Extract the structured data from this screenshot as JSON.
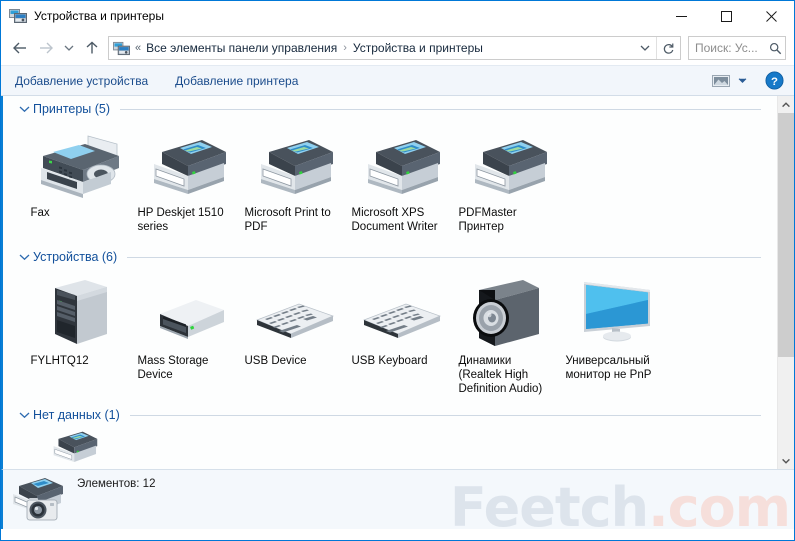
{
  "window": {
    "title": "Устройства и принтеры",
    "title_icon": "devices-printers-icon",
    "minimize_label": "─",
    "maximize_label": "□",
    "close_label": "✕"
  },
  "nav": {
    "back_icon": "back-arrow-icon",
    "forward_icon": "forward-arrow-icon",
    "recent_icon": "chevron-down-icon",
    "up_icon": "up-arrow-icon",
    "address_icon": "devices-printers-icon",
    "overflow": "«",
    "breadcrumbs": [
      "Все элементы панели управления",
      "Устройства и принтеры"
    ],
    "separator": "›",
    "dropdown_icon": "chevron-down-icon",
    "refresh_icon": "refresh-icon",
    "search_value": "Поиск: Ус...",
    "search_icon": "search-icon"
  },
  "toolbar": {
    "add_device_label": "Добавление устройства",
    "add_printer_label": "Добавление принтера",
    "view_icon": "view-options-icon",
    "view_caret_icon": "chevron-down-icon",
    "help_icon": "help-icon",
    "help_label": "?"
  },
  "groups": [
    {
      "id": "printers",
      "chevron": "⌄",
      "title": "Принтеры (5)",
      "items": [
        {
          "name": "Fax",
          "icon": "fax-machine-icon"
        },
        {
          "name": "HP Deskjet 1510 series",
          "icon": "printer-icon"
        },
        {
          "name": "Microsoft Print to PDF",
          "icon": "printer-icon"
        },
        {
          "name": "Microsoft XPS Document Writer",
          "icon": "printer-icon"
        },
        {
          "name": "PDFMaster Принтер",
          "icon": "printer-icon"
        }
      ]
    },
    {
      "id": "devices",
      "chevron": "⌄",
      "title": "Устройства (6)",
      "items": [
        {
          "name": "FYLHTQ12",
          "icon": "computer-tower-icon"
        },
        {
          "name": "Mass Storage Device",
          "icon": "external-drive-icon"
        },
        {
          "name": "USB Device",
          "icon": "keyboard-icon"
        },
        {
          "name": "USB Keyboard",
          "icon": "keyboard-icon"
        },
        {
          "name": "Динамики (Realtek High Definition Audio)",
          "icon": "speaker-icon"
        },
        {
          "name": "Универсальный монитор не PnP",
          "icon": "monitor-icon"
        }
      ]
    },
    {
      "id": "nodata",
      "chevron": "⌄",
      "title": "Нет данных (1)",
      "items": [
        {
          "name": "",
          "icon": "printer-icon"
        }
      ]
    }
  ],
  "scrollbar": {
    "up_icon": "scroll-up-icon",
    "down_icon": "scroll-down-icon"
  },
  "statusbar": {
    "icon": "camera-printer-icon",
    "text": "Элементов: 12"
  },
  "watermark": {
    "part1": "Feetch",
    "part2": ".com"
  },
  "colors": {
    "accent_blue": "#0a7fd4",
    "link_blue": "#1b4c8c",
    "group_title": "#12509b",
    "toolbar_bg": "#f2f6fb",
    "content_bg": "#fdfefe",
    "status_bg": "#f4f8fc",
    "watermark_gray": "#dde4ec",
    "watermark_pink": "#f6dfdb"
  }
}
